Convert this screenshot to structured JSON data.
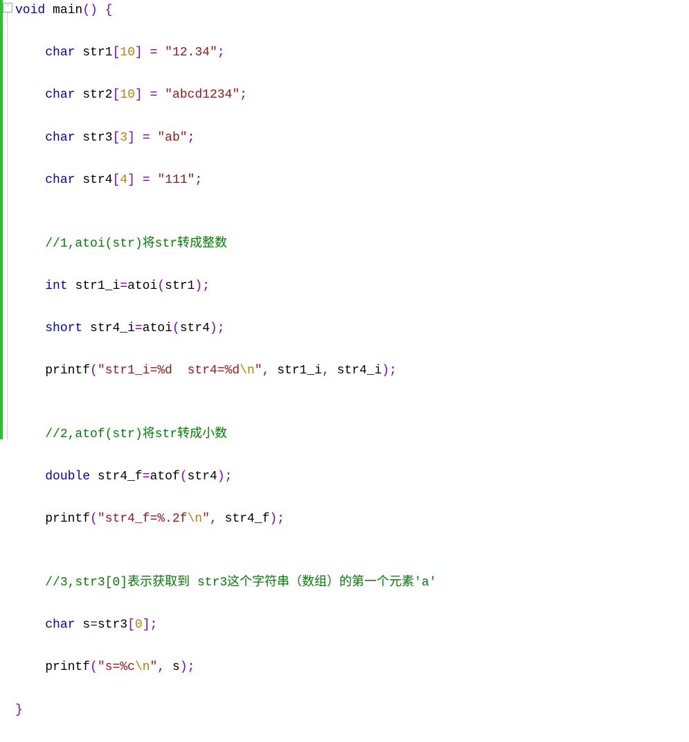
{
  "gutter": {
    "fold_symbol": "−"
  },
  "code": {
    "lines": [
      [
        {
          "cls": "kw",
          "t": "void"
        },
        {
          "cls": "",
          "t": " "
        },
        {
          "cls": "fn",
          "t": "main"
        },
        {
          "cls": "op",
          "t": "()"
        },
        {
          "cls": "",
          "t": " "
        },
        {
          "cls": "brace",
          "t": "{"
        }
      ],
      [
        {
          "cls": "",
          "t": "    "
        },
        {
          "cls": "kw",
          "t": "char"
        },
        {
          "cls": "",
          "t": " "
        },
        {
          "cls": "id",
          "t": "str1"
        },
        {
          "cls": "op",
          "t": "["
        },
        {
          "cls": "num",
          "t": "10"
        },
        {
          "cls": "op",
          "t": "]"
        },
        {
          "cls": "",
          "t": " "
        },
        {
          "cls": "op",
          "t": "="
        },
        {
          "cls": "",
          "t": " "
        },
        {
          "cls": "str",
          "t": "\"12.34\""
        },
        {
          "cls": "op",
          "t": ";"
        }
      ],
      [
        {
          "cls": "",
          "t": "    "
        },
        {
          "cls": "kw",
          "t": "char"
        },
        {
          "cls": "",
          "t": " "
        },
        {
          "cls": "id",
          "t": "str2"
        },
        {
          "cls": "op",
          "t": "["
        },
        {
          "cls": "num",
          "t": "10"
        },
        {
          "cls": "op",
          "t": "]"
        },
        {
          "cls": "",
          "t": " "
        },
        {
          "cls": "op",
          "t": "="
        },
        {
          "cls": "",
          "t": " "
        },
        {
          "cls": "str",
          "t": "\"abcd1234\""
        },
        {
          "cls": "op",
          "t": ";"
        }
      ],
      [
        {
          "cls": "",
          "t": "    "
        },
        {
          "cls": "kw",
          "t": "char"
        },
        {
          "cls": "",
          "t": " "
        },
        {
          "cls": "id",
          "t": "str3"
        },
        {
          "cls": "op",
          "t": "["
        },
        {
          "cls": "num",
          "t": "3"
        },
        {
          "cls": "op",
          "t": "]"
        },
        {
          "cls": "",
          "t": " "
        },
        {
          "cls": "op",
          "t": "="
        },
        {
          "cls": "",
          "t": " "
        },
        {
          "cls": "str",
          "t": "\"ab\""
        },
        {
          "cls": "op",
          "t": ";"
        }
      ],
      [
        {
          "cls": "",
          "t": "    "
        },
        {
          "cls": "kw",
          "t": "char"
        },
        {
          "cls": "",
          "t": " "
        },
        {
          "cls": "id",
          "t": "str4"
        },
        {
          "cls": "op",
          "t": "["
        },
        {
          "cls": "num",
          "t": "4"
        },
        {
          "cls": "op",
          "t": "]"
        },
        {
          "cls": "",
          "t": " "
        },
        {
          "cls": "op",
          "t": "="
        },
        {
          "cls": "",
          "t": " "
        },
        {
          "cls": "str",
          "t": "\"111\""
        },
        {
          "cls": "op",
          "t": ";"
        }
      ],
      [
        {
          "cls": "",
          "t": ""
        }
      ],
      [
        {
          "cls": "",
          "t": "    "
        },
        {
          "cls": "cmt",
          "t": "//1,atoi(str)将str转成整数"
        }
      ],
      [
        {
          "cls": "",
          "t": "    "
        },
        {
          "cls": "kw",
          "t": "int"
        },
        {
          "cls": "",
          "t": " "
        },
        {
          "cls": "id",
          "t": "str1_i"
        },
        {
          "cls": "op",
          "t": "="
        },
        {
          "cls": "fn",
          "t": "atoi"
        },
        {
          "cls": "op",
          "t": "("
        },
        {
          "cls": "id",
          "t": "str1"
        },
        {
          "cls": "op",
          "t": ");"
        }
      ],
      [
        {
          "cls": "",
          "t": "    "
        },
        {
          "cls": "kw",
          "t": "short"
        },
        {
          "cls": "",
          "t": " "
        },
        {
          "cls": "id",
          "t": "str4_i"
        },
        {
          "cls": "op",
          "t": "="
        },
        {
          "cls": "fn",
          "t": "atoi"
        },
        {
          "cls": "op",
          "t": "("
        },
        {
          "cls": "id",
          "t": "str4"
        },
        {
          "cls": "op",
          "t": ");"
        }
      ],
      [
        {
          "cls": "",
          "t": "    "
        },
        {
          "cls": "fn",
          "t": "printf"
        },
        {
          "cls": "op",
          "t": "("
        },
        {
          "cls": "str",
          "t": "\"str1_i=%d  str4=%d"
        },
        {
          "cls": "esc",
          "t": "\\n"
        },
        {
          "cls": "str",
          "t": "\""
        },
        {
          "cls": "op",
          "t": ","
        },
        {
          "cls": "",
          "t": " "
        },
        {
          "cls": "id",
          "t": "str1_i"
        },
        {
          "cls": "op",
          "t": ","
        },
        {
          "cls": "",
          "t": " "
        },
        {
          "cls": "id",
          "t": "str4_i"
        },
        {
          "cls": "op",
          "t": ");"
        }
      ],
      [
        {
          "cls": "",
          "t": ""
        }
      ],
      [
        {
          "cls": "",
          "t": "    "
        },
        {
          "cls": "cmt",
          "t": "//2,atof(str)将str转成小数"
        }
      ],
      [
        {
          "cls": "",
          "t": "    "
        },
        {
          "cls": "kw",
          "t": "double"
        },
        {
          "cls": "",
          "t": " "
        },
        {
          "cls": "id",
          "t": "str4_f"
        },
        {
          "cls": "op",
          "t": "="
        },
        {
          "cls": "fn",
          "t": "atof"
        },
        {
          "cls": "op",
          "t": "("
        },
        {
          "cls": "id",
          "t": "str4"
        },
        {
          "cls": "op",
          "t": ");"
        }
      ],
      [
        {
          "cls": "",
          "t": "    "
        },
        {
          "cls": "fn",
          "t": "printf"
        },
        {
          "cls": "op",
          "t": "("
        },
        {
          "cls": "str",
          "t": "\"str4_f=%.2f"
        },
        {
          "cls": "esc",
          "t": "\\n"
        },
        {
          "cls": "str",
          "t": "\""
        },
        {
          "cls": "op",
          "t": ","
        },
        {
          "cls": "",
          "t": " "
        },
        {
          "cls": "id",
          "t": "str4_f"
        },
        {
          "cls": "op",
          "t": ");"
        }
      ],
      [
        {
          "cls": "",
          "t": ""
        }
      ],
      [
        {
          "cls": "",
          "t": "    "
        },
        {
          "cls": "cmt",
          "t": "//3,str3[0]表示获取到 str3这个字符串（数组）的第一个元素'a'"
        }
      ],
      [
        {
          "cls": "",
          "t": "    "
        },
        {
          "cls": "kw",
          "t": "char"
        },
        {
          "cls": "",
          "t": " "
        },
        {
          "cls": "id",
          "t": "s"
        },
        {
          "cls": "op",
          "t": "="
        },
        {
          "cls": "id",
          "t": "str3"
        },
        {
          "cls": "op",
          "t": "["
        },
        {
          "cls": "num",
          "t": "0"
        },
        {
          "cls": "op",
          "t": "];"
        }
      ],
      [
        {
          "cls": "",
          "t": "    "
        },
        {
          "cls": "fn",
          "t": "printf"
        },
        {
          "cls": "op",
          "t": "("
        },
        {
          "cls": "str",
          "t": "\"s=%c"
        },
        {
          "cls": "esc",
          "t": "\\n"
        },
        {
          "cls": "str",
          "t": "\""
        },
        {
          "cls": "op",
          "t": ","
        },
        {
          "cls": "",
          "t": " "
        },
        {
          "cls": "id",
          "t": "s"
        },
        {
          "cls": "op",
          "t": ");"
        }
      ],
      [
        {
          "cls": "brace",
          "t": "}"
        }
      ]
    ],
    "current_line_index": 14
  }
}
